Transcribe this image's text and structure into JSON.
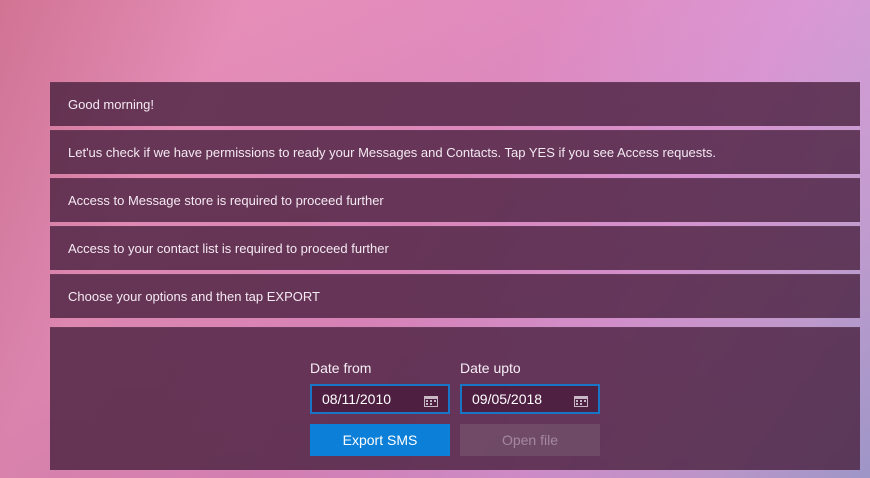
{
  "messages": [
    "Good morning!",
    "Let'us check if we have permissions to ready your Messages and Contacts. Tap YES if you see Access requests.",
    "Access to Message store is required to proceed further",
    "Access to your contact list is required to proceed further",
    "Choose your options and then tap EXPORT"
  ],
  "form": {
    "date_from_label": "Date from",
    "date_from_value": "08/11/2010",
    "date_upto_label": "Date upto",
    "date_upto_value": "09/05/2018",
    "export_button": "Export SMS",
    "open_file_button": "Open file"
  },
  "icons": {
    "date_from": "calendar-icon",
    "date_upto": "calendar-icon"
  }
}
